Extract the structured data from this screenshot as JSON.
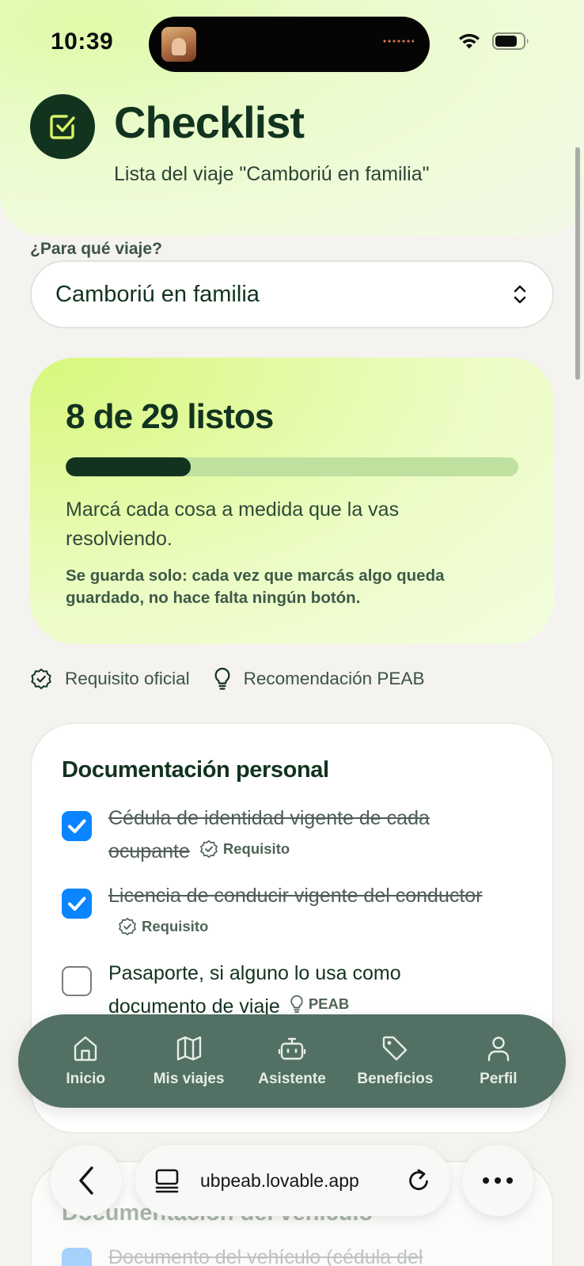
{
  "status_bar": {
    "time": "10:39"
  },
  "header": {
    "title": "Checklist",
    "subtitle": "Lista del viaje \"Camboriú en familia\""
  },
  "trip_selector": {
    "label": "¿Para qué viaje?",
    "value": "Camboriú en familia"
  },
  "progress": {
    "count_text": "8 de 29 listos",
    "done": 8,
    "total": 29,
    "hint": "Marcá cada cosa a medida que la vas resolviendo.",
    "note": "Se guarda solo: cada vez que marcás algo queda guardado, no hace falta ningún botón."
  },
  "legend": {
    "official": "Requisito oficial",
    "recommendation": "Recomendación PEAB"
  },
  "sections": [
    {
      "title": "Documentación personal",
      "items": [
        {
          "text": "Cédula de identidad vigente de cada ocupante",
          "checked": true,
          "tag": "Requisito",
          "tag_icon": "check-badge-icon"
        },
        {
          "text": "Licencia de conducir vigente del conductor",
          "checked": true,
          "tag": "Requisito",
          "tag_icon": "check-badge-icon"
        },
        {
          "text": "Pasaporte, si alguno lo usa como documento de viaje",
          "checked": false,
          "tag": "PEAB",
          "tag_icon": "lightbulb-icon"
        }
      ]
    },
    {
      "title": "Documentación del vehículo",
      "items": [
        {
          "text": "Documento del vehículo (cédula del",
          "checked": true
        }
      ]
    }
  ],
  "bottom_nav": {
    "items": [
      {
        "label": "Inicio",
        "icon": "home-icon"
      },
      {
        "label": "Mis viajes",
        "icon": "map-icon"
      },
      {
        "label": "Asistente",
        "icon": "robot-icon"
      },
      {
        "label": "Beneficios",
        "icon": "tag-icon"
      },
      {
        "label": "Perfil",
        "icon": "user-icon"
      }
    ]
  },
  "browser": {
    "url": "ubpeab.lovable.app"
  },
  "colors": {
    "primary_dark": "#12341f",
    "checkbox_blue": "#0a84ff",
    "nav_bg": "#527063",
    "progress_track": "#c0e0a0"
  }
}
